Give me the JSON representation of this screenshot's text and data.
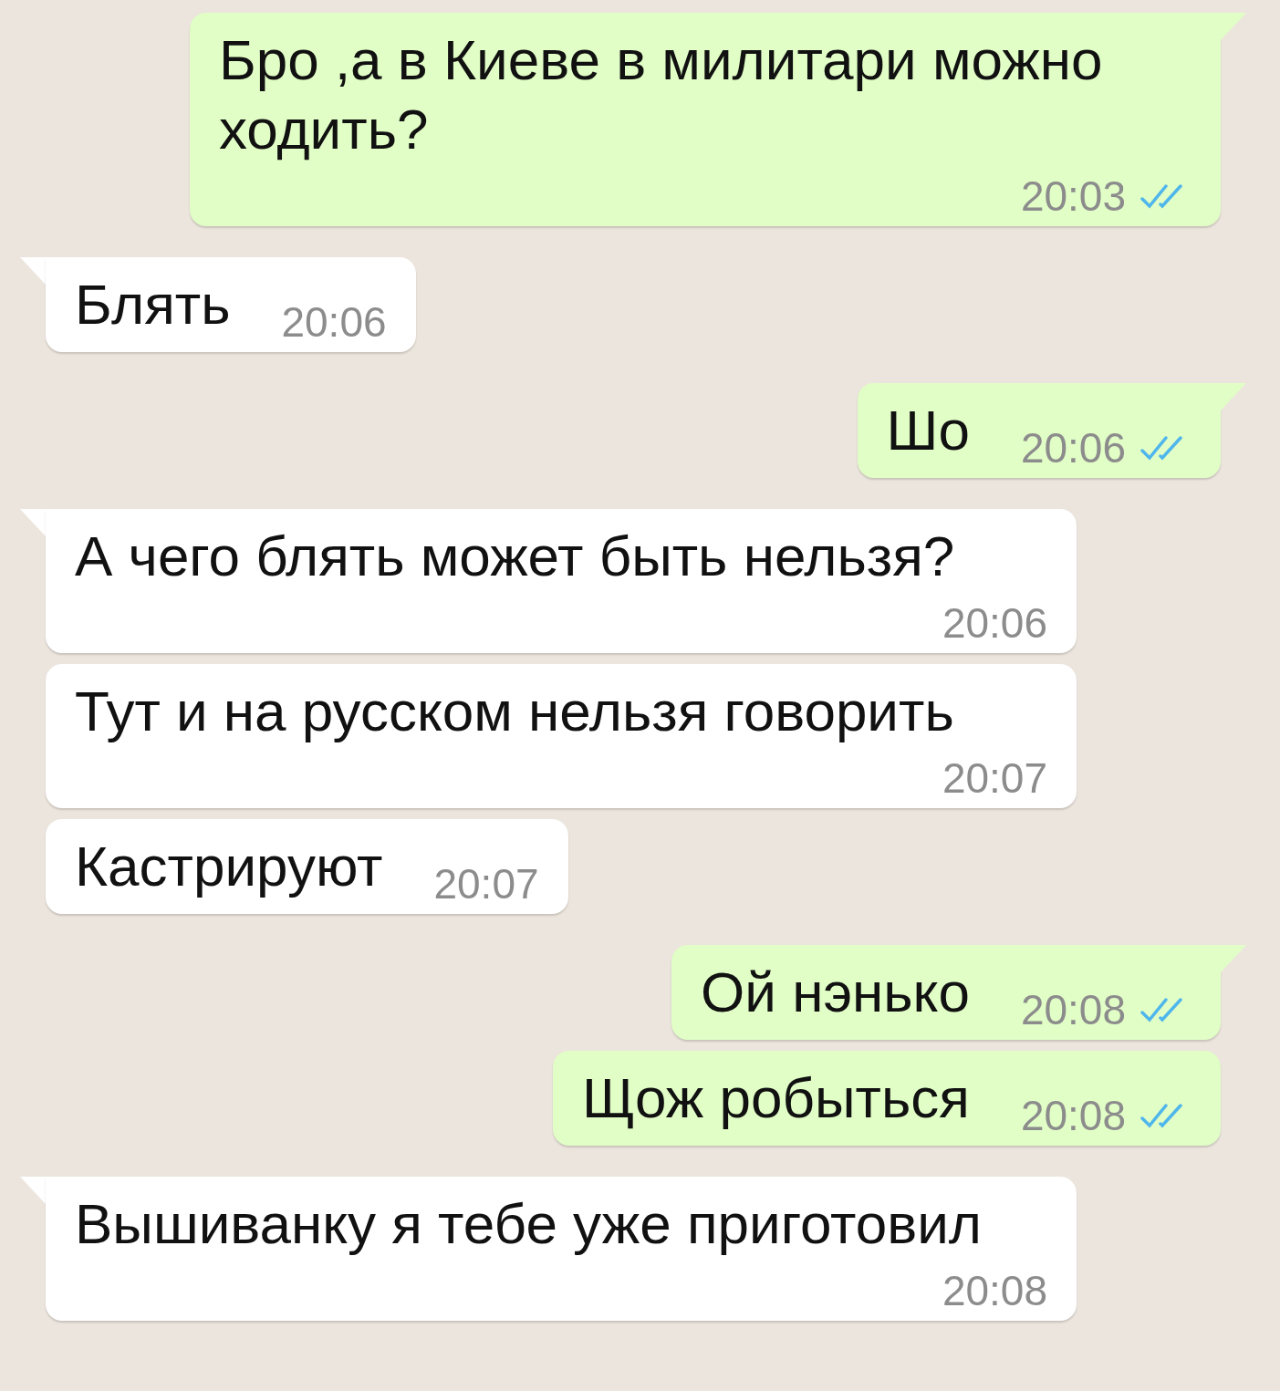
{
  "messages": [
    {
      "kind": "outgoing",
      "text": "Бро ,а в Киеве в милитари можно ходить?",
      "time": "20:03",
      "read": true
    },
    {
      "kind": "incoming",
      "text": "Блять",
      "time": "20:06"
    },
    {
      "kind": "outgoing",
      "text": "Шо",
      "time": "20:06",
      "read": true
    },
    {
      "kind": "incoming",
      "text": "А чего блять может быть нельзя?",
      "time": "20:06"
    },
    {
      "kind": "incoming",
      "text": "Тут и на русском нельзя говорить",
      "time": "20:07"
    },
    {
      "kind": "incoming",
      "text": "Кастрируют",
      "time": "20:07"
    },
    {
      "kind": "outgoing",
      "text": "Ой нэнько",
      "time": "20:08",
      "read": true
    },
    {
      "kind": "outgoing",
      "text": "Щож робыться",
      "time": "20:08",
      "read": true
    },
    {
      "kind": "incoming",
      "text": "Вышиванку я тебе уже приготовил",
      "time": "20:08"
    }
  ]
}
